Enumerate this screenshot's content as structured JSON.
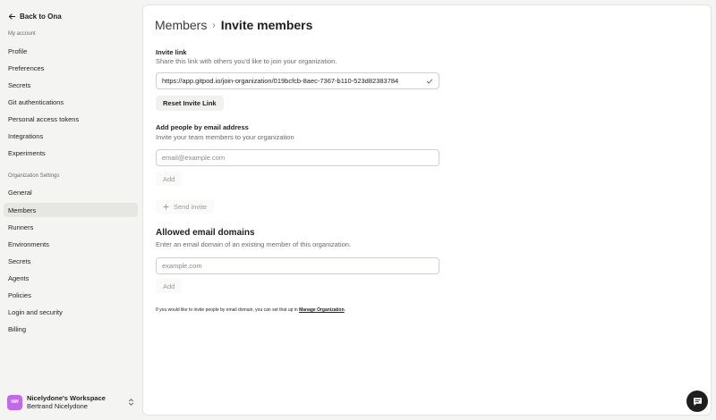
{
  "sidebar": {
    "back_label": "Back to Ona",
    "my_account_label": "My account",
    "account_items": [
      "Profile",
      "Preferences",
      "Secrets",
      "Git authentications",
      "Personal access tokens",
      "Integrations",
      "Experiments"
    ],
    "org_label": "Organization Settings",
    "org_items": [
      "General",
      "Members",
      "Runners",
      "Environments",
      "Secrets",
      "Agents",
      "Policies",
      "Login and security",
      "Billing"
    ],
    "active_item": "Members",
    "workspace": {
      "initials": "NW",
      "name": "Nicelydone's Workspace",
      "user": "Bertrand Nicelydone",
      "avatar_color": "#c06ae8"
    }
  },
  "breadcrumb": {
    "parent": "Members",
    "current": "Invite members"
  },
  "invite_link": {
    "title": "Invite link",
    "description": "Share this link with others you'd like to join your organization.",
    "url": "https://app.gitpod.io/join-organization/019bcfcb-8aec-7367-b110-523d82383784",
    "reset_label": "Reset Invite Link"
  },
  "email_invite": {
    "title": "Add people by email address",
    "description": "Invite your team members to your organization",
    "placeholder": "email@example.com",
    "add_label": "Add",
    "send_label": "Send invite"
  },
  "domains": {
    "title": "Allowed email domains",
    "description": "Enter an email domain of an existing member of this organization.",
    "placeholder": "example.com",
    "add_label": "Add"
  },
  "footnote": {
    "text": "If you would like to invite people by email domain, you can set that up in ",
    "link": "Manage Organization",
    "suffix": "."
  },
  "icons": {
    "back": "arrow-left-icon",
    "check": "check-icon",
    "plus": "plus-icon",
    "chevron": "chevron-up-down-icon",
    "chat": "chat-icon"
  }
}
